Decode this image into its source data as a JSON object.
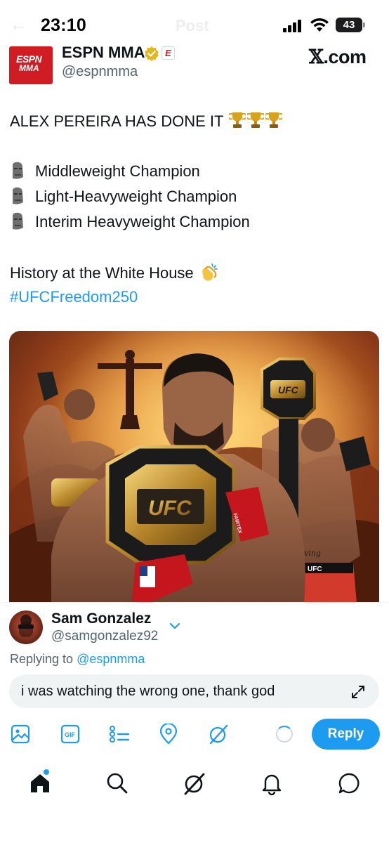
{
  "status_bar": {
    "time": "23:10",
    "battery": "43",
    "ghost_title": "Post"
  },
  "tweet": {
    "author_name": "ESPN MMA",
    "author_handle": "@espnmma",
    "avatar_text_top": "ESPN",
    "avatar_text_bottom": "MMA",
    "affiliation_badge": "E",
    "watermark": "X.com",
    "headline": "ALEX PEREIRA HAS DONE IT",
    "titles": [
      "Middleweight Champion",
      "Light-Heavyweight Champion",
      "Interim Heavyweight Champion"
    ],
    "history_line": "History at the White House",
    "hashtag": "#UFCFreedom250",
    "media_labels": {
      "belt": "UFC",
      "glove": "FAIRTEX",
      "trunks": "UFC",
      "tattoo": "Kraving"
    }
  },
  "reply": {
    "replier_name": "Sam Gonzalez",
    "replier_handle": "@samgonzalez92",
    "replying_to_label": "Replying to",
    "replying_to_handle": "@espnmma",
    "input_value": "i was watching the wrong one, thank god",
    "reply_button": "Reply",
    "toolbar": [
      "image-icon",
      "gif-icon",
      "poll-icon",
      "location-icon",
      "grok-icon"
    ]
  },
  "nav": [
    "home-icon",
    "search-icon",
    "grok-icon",
    "notifications-icon",
    "messages-icon"
  ],
  "colors": {
    "accent": "#1d9bf0",
    "espn_red": "#d01d24",
    "verified_gold": "#e2b719"
  }
}
